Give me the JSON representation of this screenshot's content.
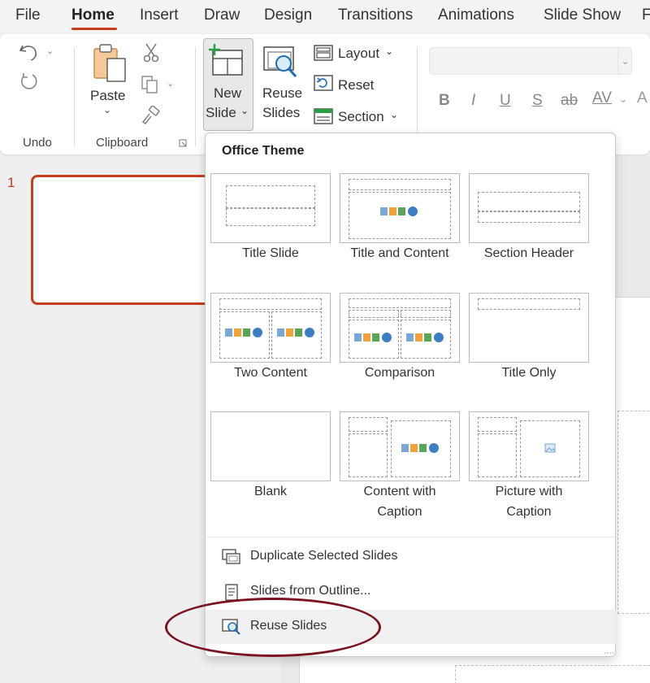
{
  "tabs": [
    "File",
    "Home",
    "Insert",
    "Draw",
    "Design",
    "Transitions",
    "Animations",
    "Slide Show",
    "F"
  ],
  "active_tab": "Home",
  "accent_color": "#c43e1c",
  "annotation_color": "#7b1420",
  "ribbon": {
    "undo_group": "Undo",
    "clipboard_group": "Clipboard",
    "paste": "Paste",
    "new_slide_line1": "New",
    "new_slide_line2": "Slide",
    "reuse_line1": "Reuse",
    "reuse_line2": "Slides",
    "layout": "Layout",
    "reset": "Reset",
    "section": "Section",
    "format_buttons": [
      "B",
      "I",
      "U",
      "S",
      "ab",
      "AV"
    ]
  },
  "slide_panel": {
    "slide_number": "1"
  },
  "dropdown": {
    "title": "Office Theme",
    "layouts": [
      {
        "label": "Title Slide"
      },
      {
        "label": "Title and Content"
      },
      {
        "label": "Section Header"
      },
      {
        "label": "Two Content"
      },
      {
        "label": "Comparison"
      },
      {
        "label": "Title Only"
      },
      {
        "label": "Blank"
      },
      {
        "label_line1": "Content with",
        "label_line2": "Caption"
      },
      {
        "label_line1": "Picture with",
        "label_line2": "Caption"
      }
    ],
    "items": [
      {
        "label": "Duplicate Selected Slides",
        "icon": "duplicate-slides-icon"
      },
      {
        "label": "Slides from Outline...",
        "icon": "outline-icon"
      },
      {
        "label": "Reuse Slides",
        "icon": "reuse-slides-icon"
      }
    ]
  }
}
